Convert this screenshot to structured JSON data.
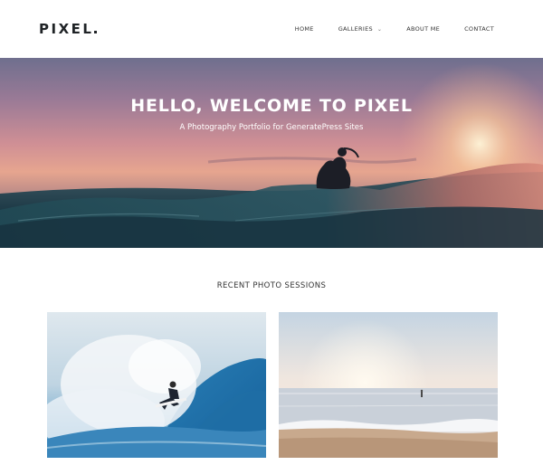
{
  "header": {
    "logo": "PIXEL",
    "nav": [
      {
        "label": "HOME"
      },
      {
        "label": "GALLERIES",
        "has_dropdown": true
      },
      {
        "label": "ABOUT ME"
      },
      {
        "label": "CONTACT"
      }
    ]
  },
  "hero": {
    "title": "HELLO, WELCOME TO PIXEL",
    "subtitle": "A Photography Portfolio for GeneratePress Sites"
  },
  "recent": {
    "title": "RECENT PHOTO SESSIONS"
  },
  "colors": {
    "text_dark": "#1f2326",
    "nav_text": "#333333"
  },
  "icons": {
    "dropdown": "chevron-down-icon"
  }
}
